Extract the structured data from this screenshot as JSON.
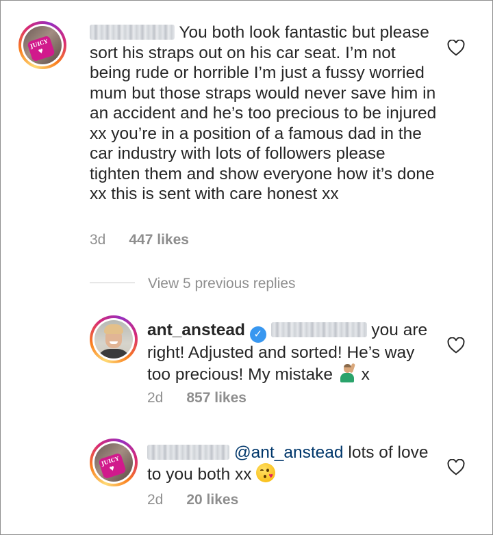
{
  "comments": [
    {
      "username_blurred": true,
      "text": "You both look fantastic but please sort his straps out on his car seat. I’m not being rude or horrible I’m just a fussy worried mum but those straps would never save him in an accident and he’s too precious to be injured xx you’re in a position of a famous dad in the car industry with lots of followers please tighten them and show everyone how it’s done xx this is sent with care honest xx",
      "time": "3d",
      "likes": "447 likes",
      "avatar_label": "JUICY"
    }
  ],
  "view_replies": "View 5 previous replies",
  "replies": [
    {
      "username": "ant_anstead",
      "verified": true,
      "text_before": "you are right! Adjusted and sorted! He’s way too precious! My mistake",
      "text_after": "x",
      "emoji": "man-raising-hand-emoji",
      "time": "2d",
      "likes": "857 likes"
    },
    {
      "username_blurred": true,
      "mention": "@ant_anstead",
      "text": "lots of love to you both xx",
      "emoji": "face-blowing-kiss-emoji",
      "time": "2d",
      "likes": "20 likes",
      "avatar_label": "JUICY"
    }
  ],
  "colors": {
    "text": "#262626",
    "meta": "#8e8e8e",
    "mention": "#00376b",
    "verified": "#3897f0"
  }
}
